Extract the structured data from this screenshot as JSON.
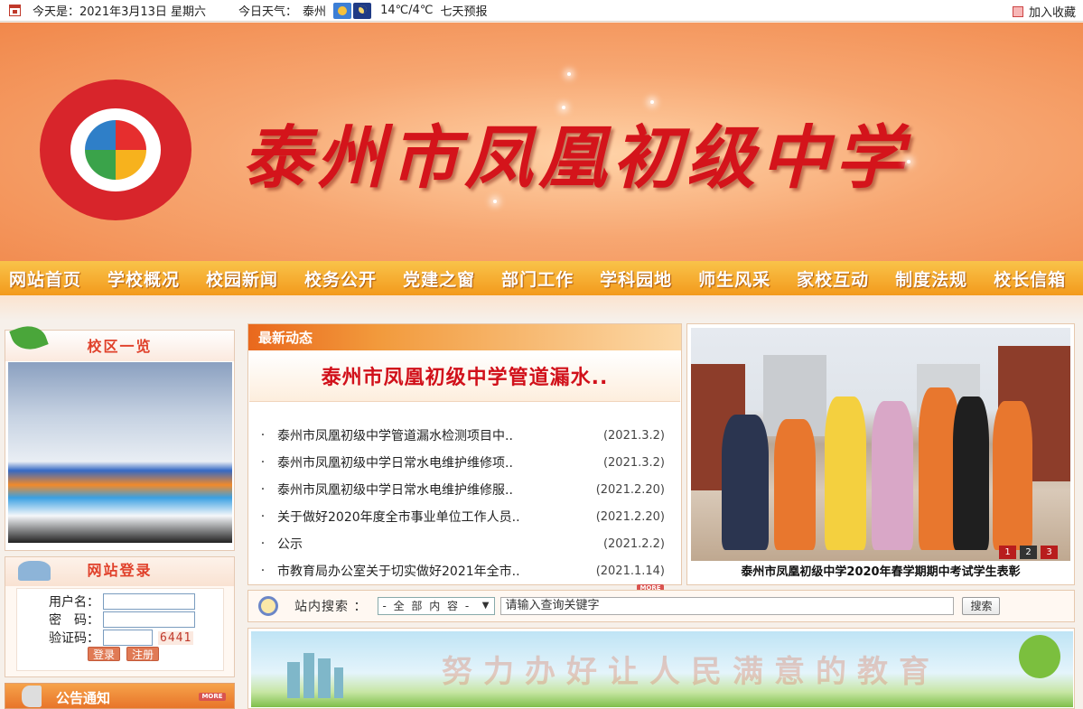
{
  "topbar": {
    "date": "今天是：2021年3月13日 星期六",
    "weather_label": "今日天气：",
    "city": "泰州",
    "temp": "14℃/4℃",
    "forecast": "七天预报",
    "favorite": "加入收藏"
  },
  "banner": {
    "title": "泰州市凤凰初级中学"
  },
  "nav": {
    "items": [
      "网站首页",
      "学校概况",
      "校园新闻",
      "校务公开",
      "党建之窗",
      "部门工作",
      "学科园地",
      "师生风采",
      "家校互动",
      "制度法规",
      "校长信箱"
    ]
  },
  "campus": {
    "title": "校区一览"
  },
  "login": {
    "title": "网站登录",
    "username_label": "用户名：",
    "password_label": "密　码：",
    "captcha_label": "验证码：",
    "captcha_code": "6441",
    "login_button": "登录",
    "register_button": "注册"
  },
  "notice": {
    "title": "公告通知",
    "more": "MORE"
  },
  "news": {
    "tab": "最新动态",
    "headline": "泰州市凤凰初级中学管道漏水..",
    "more": "MORE",
    "items": [
      {
        "title": "泰州市凤凰初级中学管道漏水检测项目中..",
        "date": "(2021.3.2)"
      },
      {
        "title": "泰州市凤凰初级中学日常水电维护维修项..",
        "date": "(2021.3.2)"
      },
      {
        "title": "泰州市凤凰初级中学日常水电维护维修服..",
        "date": "(2021.2.20)"
      },
      {
        "title": "关于做好2020年度全市事业单位工作人员..",
        "date": "(2021.2.20)"
      },
      {
        "title": "公示",
        "date": "(2021.2.2)"
      },
      {
        "title": "市教育局办公室关于切实做好2021年全市..",
        "date": "(2021.1.14)"
      }
    ]
  },
  "showcase": {
    "caption": "泰州市凤凰初级中学2020年春学期期中考试学生表彰",
    "pages": [
      "1",
      "2",
      "3"
    ]
  },
  "search": {
    "label": "站内搜索 ：",
    "scope": "- 全 部 内 容 -",
    "arrow": "▼",
    "placeholder": "请输入查询关键字",
    "button": "搜索"
  },
  "slogan": {
    "text": "努力办好让人民满意的教育"
  }
}
